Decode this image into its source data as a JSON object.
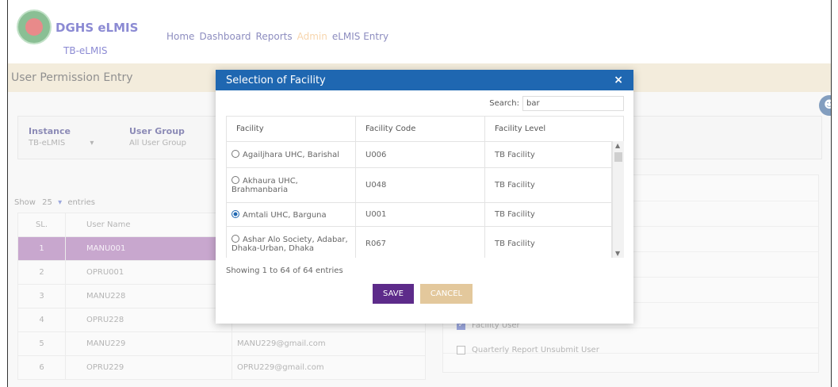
{
  "app": {
    "title": "DGHS eLMIS",
    "subtitle": "TB-eLMIS",
    "nav": [
      {
        "label": "Home",
        "active": false
      },
      {
        "label": "Dashboard",
        "active": false
      },
      {
        "label": "Reports",
        "active": false
      },
      {
        "label": "Admin",
        "active": true
      },
      {
        "label": "eLMIS Entry",
        "active": false
      }
    ]
  },
  "page": {
    "title": "User Permission Entry",
    "filters": {
      "instance_label": "Instance",
      "instance_value": "TB-eLMIS",
      "instance_arrow": "▾",
      "group_label": "User Group",
      "group_value": "All User Group"
    },
    "show_entries": {
      "prefix": "Show",
      "value": "25",
      "arrow": "▾",
      "suffix": "entries"
    },
    "table": {
      "headers": [
        "SL.",
        "User Name"
      ],
      "rows": [
        {
          "sl": "1",
          "user": "MANU001",
          "email": ""
        },
        {
          "sl": "2",
          "user": "OPRU001",
          "email": ""
        },
        {
          "sl": "3",
          "user": "MANU228",
          "email": ""
        },
        {
          "sl": "4",
          "user": "OPRU228",
          "email": ""
        },
        {
          "sl": "5",
          "user": "MANU229",
          "email": "MANU229@gmail.com"
        },
        {
          "sl": "6",
          "user": "OPRU229",
          "email": "OPRU229@gmail.com"
        }
      ]
    },
    "permissions": [
      {
        "label": "Facility User",
        "checked": true
      },
      {
        "label": "Quarterly Report Unsubmit User",
        "checked": false
      }
    ]
  },
  "modal": {
    "title": "Selection of Facility",
    "close": "×",
    "search_label": "Search:",
    "search_value": "bar",
    "columns": [
      "Facility",
      "Facility Code",
      "Facility Level"
    ],
    "rows": [
      {
        "facility": "Agailjhara UHC, Barishal",
        "code": "U006",
        "level": "TB Facility",
        "selected": false
      },
      {
        "facility": "Akhaura UHC, Brahmanbaria",
        "code": "U048",
        "level": "TB Facility",
        "selected": false
      },
      {
        "facility": "Amtali UHC, Barguna",
        "code": "U001",
        "level": "TB Facility",
        "selected": true
      },
      {
        "facility": "Ashar Alo Society, Adabar, Dhaka-Urban, Dhaka",
        "code": "R067",
        "level": "TB Facility",
        "selected": false
      }
    ],
    "showing": "Showing 1 to 64 of 64 entries",
    "save_label": "SAVE",
    "cancel_label": "CANCEL"
  },
  "colors": {
    "modal_header": "#1f67b1",
    "save_button": "#5d2b8a",
    "cancel_button": "#e3c89c",
    "selected_row": "#9c5fa7",
    "title_bar": "#eadcc0"
  },
  "icons": {
    "user": "user-icon",
    "logo": "government-logo-icon"
  }
}
